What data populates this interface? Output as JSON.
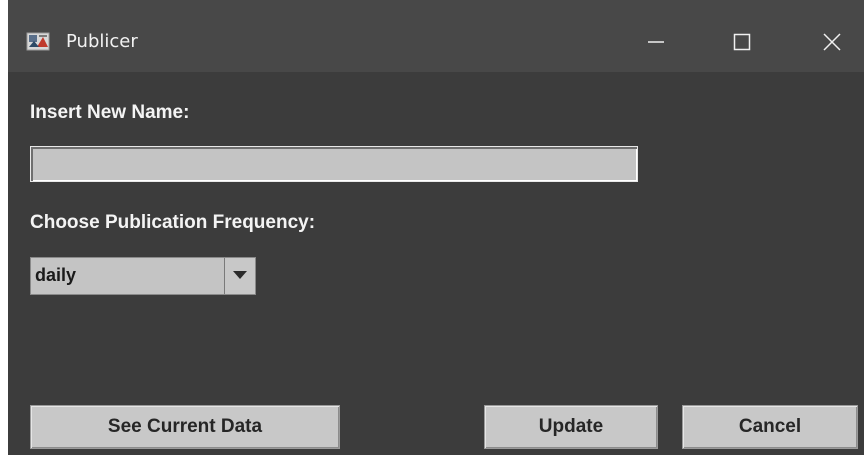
{
  "window": {
    "title": "Publicer",
    "icon": "app-icon",
    "controls": [
      "minimize-icon",
      "maximize-icon",
      "close-icon"
    ]
  },
  "form": {
    "name_label": "Insert New Name:",
    "name_value": "",
    "frequency_label": "Choose Publication Frequency:",
    "frequency_selected": "daily"
  },
  "buttons": {
    "see_current_data": "See Current Data",
    "update": "Update",
    "cancel": "Cancel"
  },
  "colors": {
    "window_bg": "#3c3c3c",
    "titlebar_bg": "#484848",
    "control_bg": "#c4c4c4",
    "label_text": "#f4f4f4"
  }
}
